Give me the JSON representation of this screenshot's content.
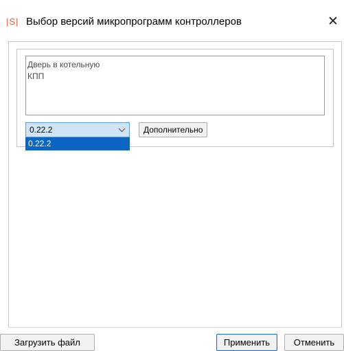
{
  "window": {
    "app_icon_text": "|S|",
    "title": "Выбор версий микропрограмм контроллеров",
    "close_symbol": "✕"
  },
  "controllers": [
    {
      "label": "Дверь в котельную"
    },
    {
      "label": "КПП"
    }
  ],
  "version_select": {
    "selected": "0.22.2",
    "options": [
      "0.22.2"
    ],
    "expanded": true,
    "highlighted_option": "0.22.2"
  },
  "buttons": {
    "advanced": "Дополнительно",
    "load_file": "Загрузить файл",
    "apply": "Применить",
    "cancel": "Отменить"
  },
  "colors": {
    "accent": "#0a66c2",
    "select_background": "#cfe4f7",
    "brand_icon": "#e4572e"
  }
}
